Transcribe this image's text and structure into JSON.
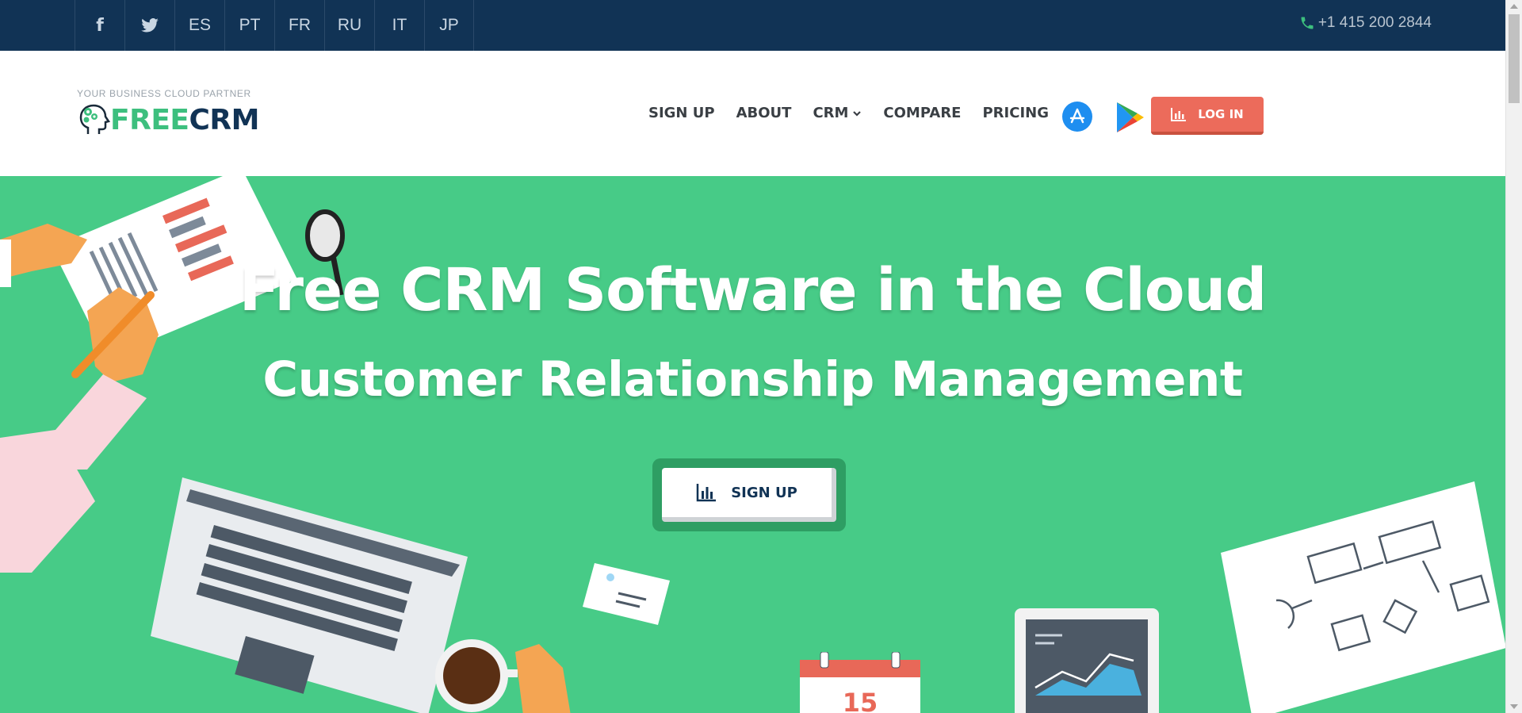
{
  "topbar": {
    "social": [
      {
        "name": "facebook-icon",
        "glyph": "f"
      },
      {
        "name": "twitter-icon",
        "glyph": "t"
      }
    ],
    "languages": [
      "ES",
      "PT",
      "FR",
      "RU",
      "IT",
      "JP"
    ],
    "phone": "+1 415 200 2844"
  },
  "header": {
    "tagline": "YOUR BUSINESS CLOUD PARTNER",
    "brand_free": "FREE",
    "brand_crm": "CRM",
    "nav": {
      "signup": "SIGN UP",
      "about": "ABOUT",
      "crm": "CRM",
      "compare": "COMPARE",
      "pricing": "PRICING"
    },
    "login": "LOG IN"
  },
  "hero": {
    "title": "Free CRM Software in the Cloud",
    "subtitle": "Customer Relationship Management",
    "cta": "SIGN UP",
    "calendar_day": "15"
  },
  "colors": {
    "topbar": "#113355",
    "brand_green": "#3dbf7e",
    "hero_green": "#47cb87",
    "login_red": "#ec6b5b",
    "navy": "#113355"
  }
}
